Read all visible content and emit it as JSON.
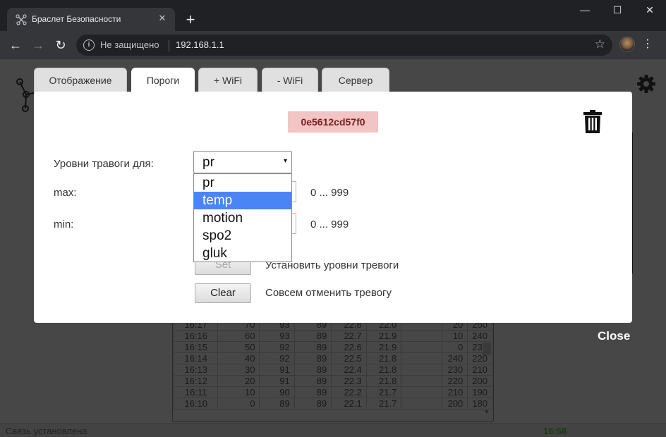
{
  "browser": {
    "tab_title": "Браслет Безопасности",
    "tab_close": "✕",
    "new_tab": "+",
    "window_controls": [
      "—",
      "☐",
      "✕"
    ],
    "back": "←",
    "forward": "→",
    "reload": "↻",
    "security_label": "Не защищено",
    "url": "192.168.1.1",
    "star": "☆",
    "menu": "⋮"
  },
  "modal_tabs": [
    {
      "label": "Отображение",
      "active": false
    },
    {
      "label": "Пороги",
      "active": true
    },
    {
      "label": "+ WiFi",
      "active": false
    },
    {
      "label": "- WiFi",
      "active": false
    },
    {
      "label": "Сервер",
      "active": false
    }
  ],
  "modal": {
    "device_id": "0e5612cd57f0",
    "alarm_levels_label": "Уровни травоги для:",
    "select_value": "pr",
    "select_arrow": "▾",
    "options": [
      {
        "label": "pr",
        "selected": false
      },
      {
        "label": "temp",
        "selected": true
      },
      {
        "label": "motion",
        "selected": false
      },
      {
        "label": "spo2",
        "selected": false
      },
      {
        "label": "gluk",
        "selected": false
      }
    ],
    "max_label": "max:",
    "min_label": "min:",
    "max_range": "0 ... 999",
    "min_range": "0 ... 999",
    "set_button": "Set",
    "set_desc": "Установить уровни тревоги",
    "clear_button": "Clear",
    "clear_desc": "Совсем отменить тревогу"
  },
  "close_label": "Close",
  "status": {
    "text": "Связь установлена",
    "time": "16:58"
  },
  "table_rows": [
    [
      "16:17",
      "70",
      "93",
      "89",
      "22.8",
      "22.0",
      "",
      "20",
      "250"
    ],
    [
      "16:16",
      "60",
      "93",
      "89",
      "22.7",
      "21.9",
      "",
      "10",
      "240"
    ],
    [
      "16:15",
      "50",
      "92",
      "89",
      "22.6",
      "21.9",
      "",
      "0",
      "230"
    ],
    [
      "16:14",
      "40",
      "92",
      "89",
      "22.5",
      "21.8",
      "",
      "240",
      "220"
    ],
    [
      "16:13",
      "30",
      "91",
      "89",
      "22.4",
      "21.8",
      "",
      "230",
      "210"
    ],
    [
      "16:12",
      "20",
      "91",
      "89",
      "22.3",
      "21.8",
      "",
      "220",
      "200"
    ],
    [
      "16:11",
      "10",
      "90",
      "89",
      "22.2",
      "21.7",
      "",
      "210",
      "190"
    ],
    [
      "16:10",
      "0",
      "89",
      "89",
      "22.1",
      "21.7",
      "",
      "200",
      "180"
    ]
  ],
  "colors": {
    "accent_selected": "#4a84f5",
    "device_id_bg": "#f2c4c4",
    "status_time": "#1b3a12"
  }
}
